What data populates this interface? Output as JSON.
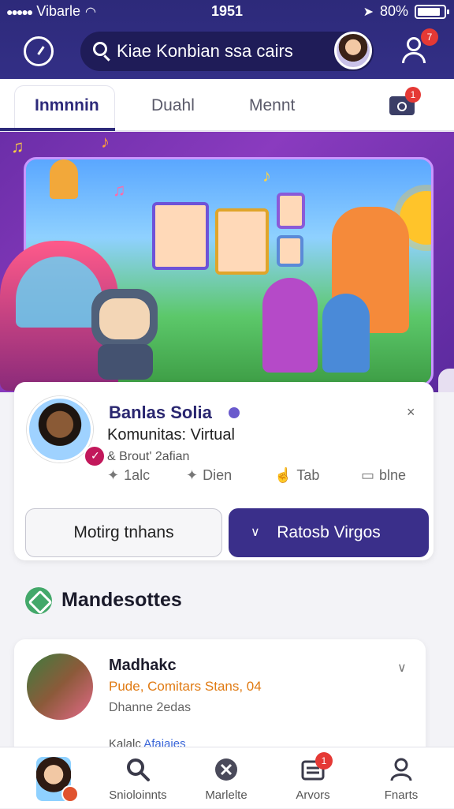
{
  "status_bar": {
    "carrier": "Vibarle",
    "time": "1951",
    "battery": "80%"
  },
  "header": {
    "search_text": "Kiae Konbian ssa cairs",
    "notification_count": "7"
  },
  "tabs": [
    {
      "label": "Inmnnin",
      "active": true
    },
    {
      "label": "Duahl",
      "active": false
    },
    {
      "label": "Mennt",
      "active": false
    }
  ],
  "tab_camera_badge": "1",
  "profile_card": {
    "name": "Banlas Solia",
    "subtitle": "Komunitas: Virtual",
    "meta": "& Brout' 2afian",
    "stats": [
      {
        "icon": "pin-icon",
        "label": "1alc"
      },
      {
        "icon": "pin-icon",
        "label": "Dien"
      },
      {
        "icon": "thumb-up-icon",
        "label": "Tab"
      },
      {
        "icon": "bookmark-icon",
        "label": "blne"
      }
    ],
    "close_symbol": "×",
    "secondary_button": "Motirg tnhans",
    "primary_button": "Ratosb Virgos",
    "primary_chevron": "∨"
  },
  "section": {
    "title": "Mandesottes"
  },
  "list_items": [
    {
      "name": "Madhakc",
      "tags": "Pude, Comitars Stans, 04",
      "meta": "Dhanne 2edas",
      "chevron": "∨",
      "second_row": "Kalalc",
      "second_row_link": "Afaiaies"
    }
  ],
  "bottom_nav": [
    {
      "label": "",
      "icon": "avatar"
    },
    {
      "label": "Snioloinnts",
      "icon": "search-icon"
    },
    {
      "label": "Marlelte",
      "icon": "compass-icon"
    },
    {
      "label": "Arvors",
      "icon": "inbox-icon",
      "badge": "1"
    },
    {
      "label": "Fnarts",
      "icon": "profile-icon"
    }
  ],
  "colors": {
    "header_bg": "#2d2a7a",
    "primary_button": "#3a2f8a",
    "badge": "#e53935",
    "section_icon": "#43a86a",
    "tags": "#e07a12"
  }
}
